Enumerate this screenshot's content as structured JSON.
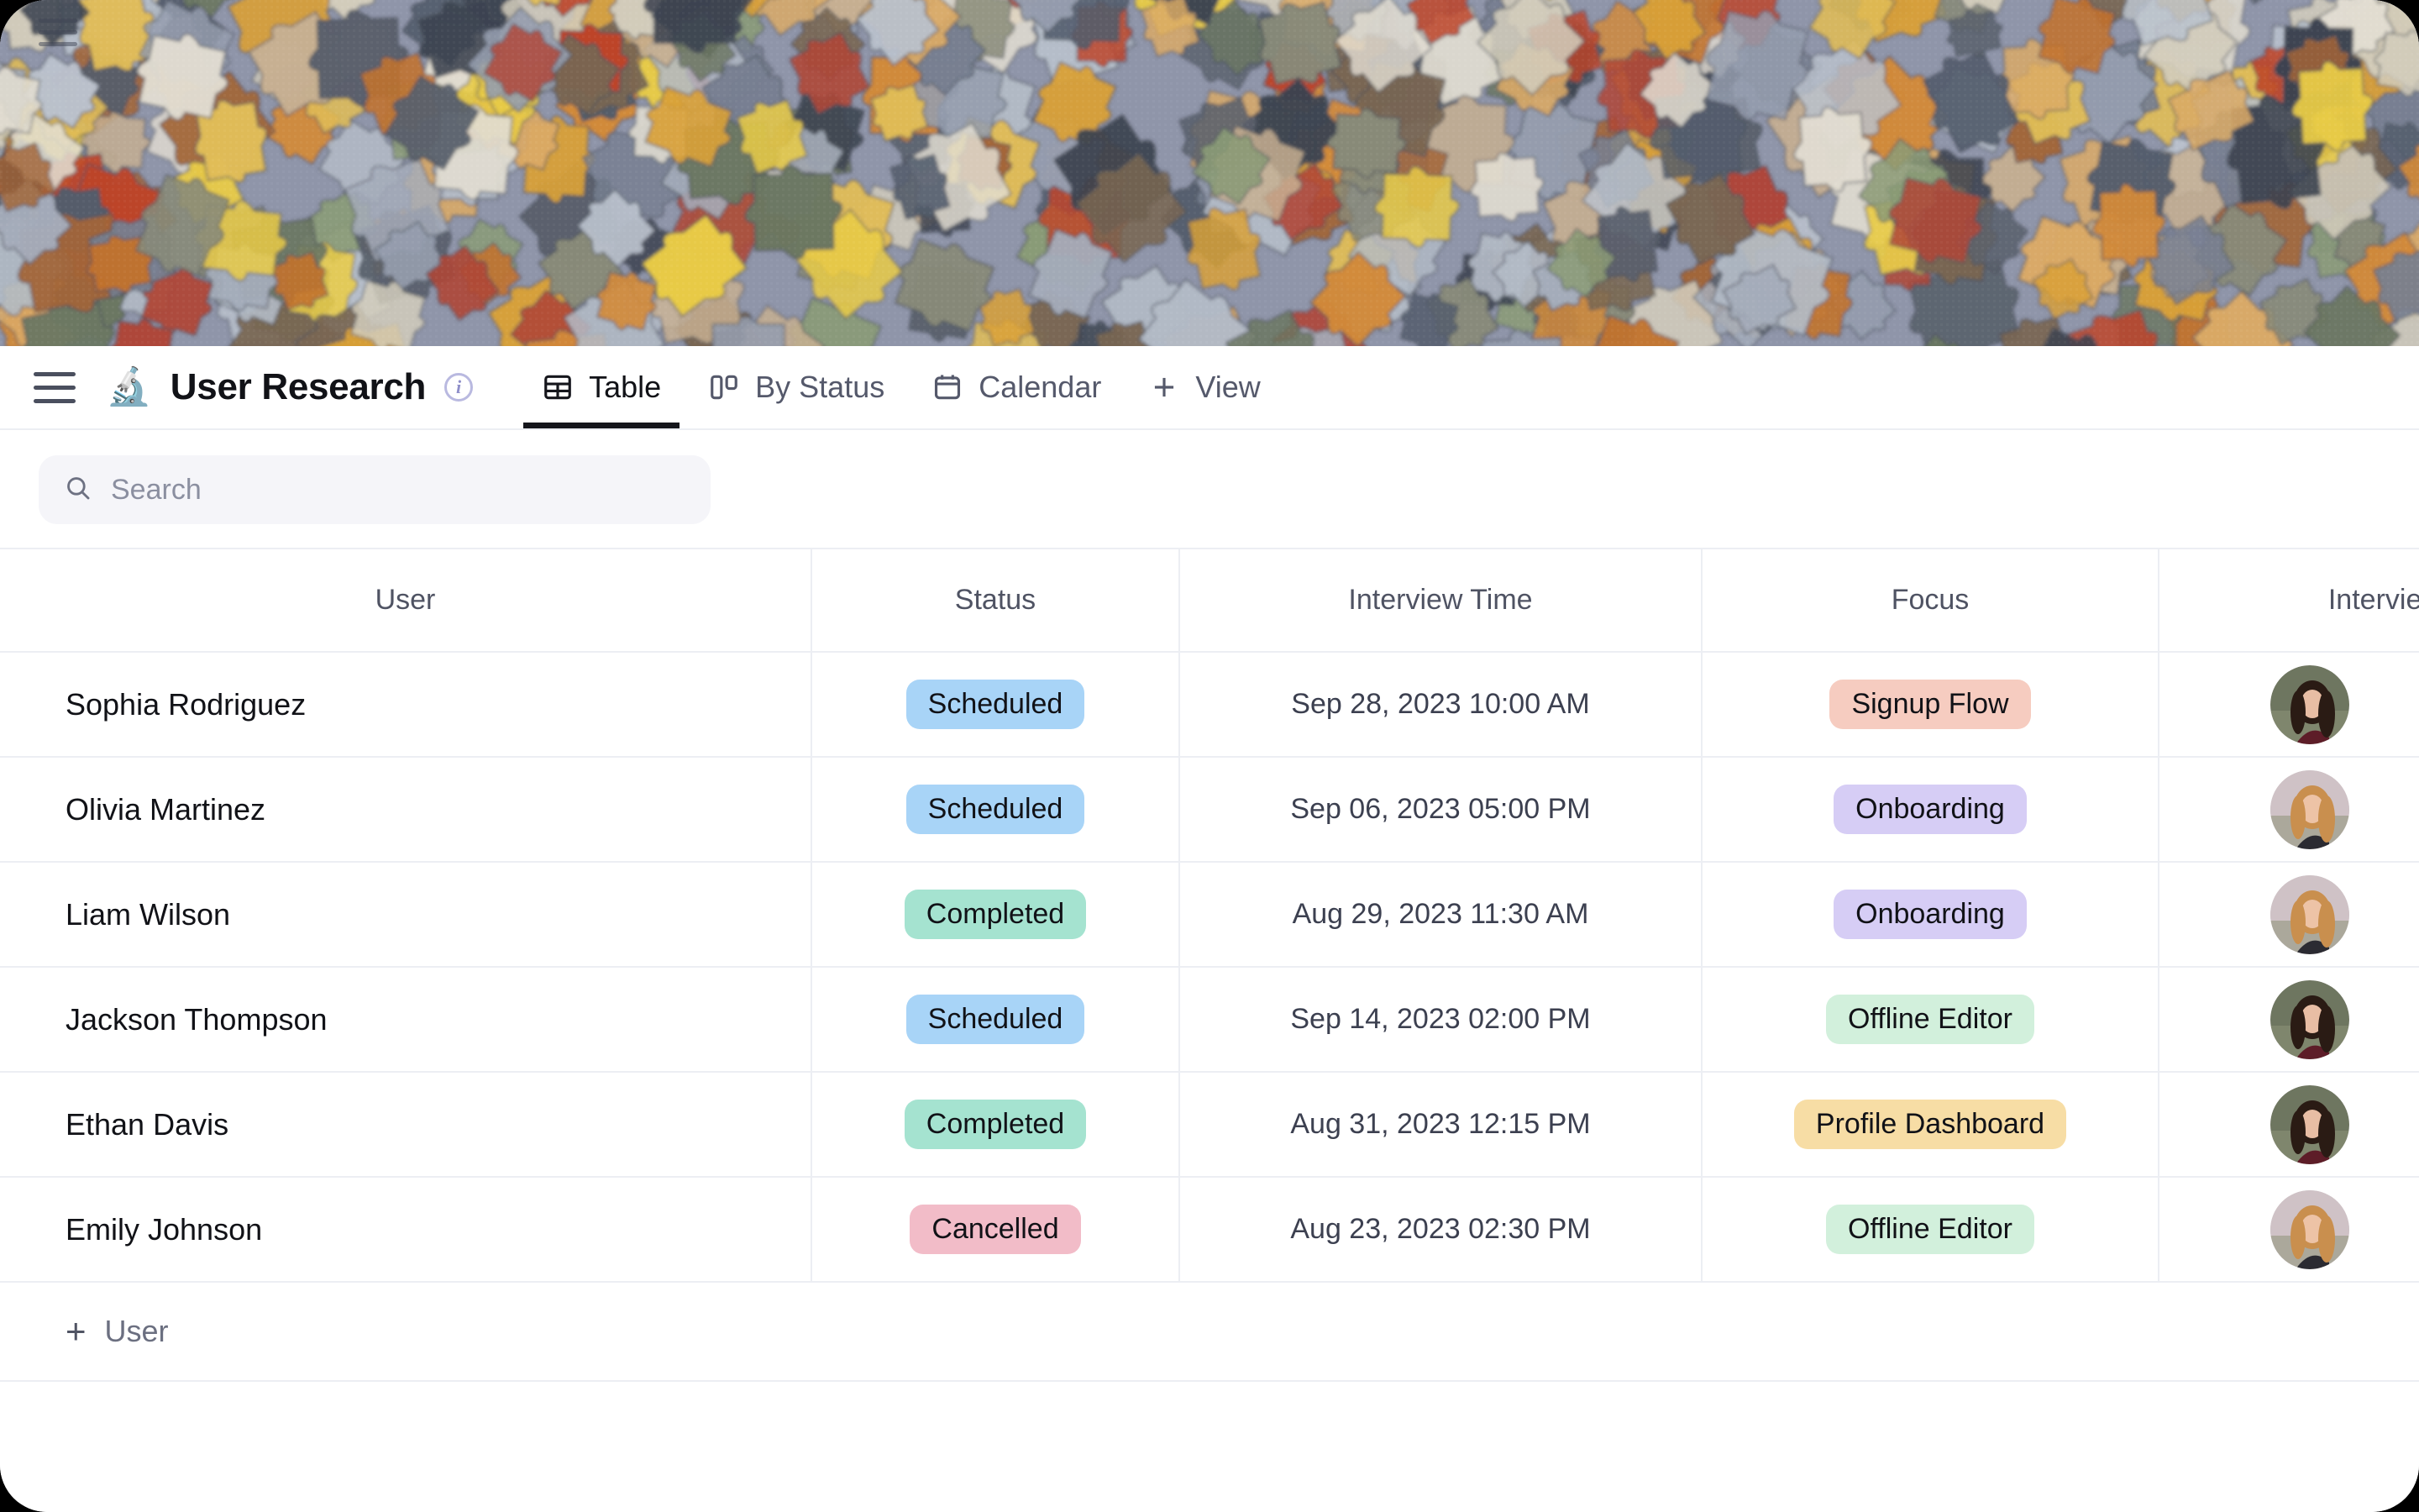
{
  "banner": {
    "alt": "jigsaw-puzzle-pieces-photo"
  },
  "header": {
    "menu_icon": "hamburger-menu-icon",
    "emoji": "🔬",
    "title": "User Research",
    "info_icon": "info-icon",
    "info_glyph": "i"
  },
  "tabs": [
    {
      "label": "Table",
      "icon": "table-icon",
      "active": true
    },
    {
      "label": "By Status",
      "icon": "board-icon",
      "active": false
    },
    {
      "label": "Calendar",
      "icon": "calendar-icon",
      "active": false
    },
    {
      "label": "View",
      "icon": "plus-icon",
      "active": false
    }
  ],
  "search": {
    "value": "",
    "placeholder": "Search",
    "icon": "search-icon"
  },
  "table": {
    "columns": [
      "User",
      "Status",
      "Interview Time",
      "Focus",
      "Interviewer"
    ],
    "rows": [
      {
        "user": "Sophia Rodriguez",
        "status": "Scheduled",
        "status_color": "#a8d4f7",
        "time": "Sep 28, 2023 10:00 AM",
        "focus": "Signup Flow",
        "focus_color": "#f6ccc0",
        "interviewer": "avatar-dark-hair-woman"
      },
      {
        "user": "Olivia Martinez",
        "status": "Scheduled",
        "status_color": "#a8d4f7",
        "time": "Sep 06, 2023 05:00 PM",
        "focus": "Onboarding",
        "focus_color": "#d6cdf5",
        "interviewer": "avatar-blonde-woman"
      },
      {
        "user": "Liam Wilson",
        "status": "Completed",
        "status_color": "#a5e3d0",
        "time": "Aug 29, 2023 11:30 AM",
        "focus": "Onboarding",
        "focus_color": "#d6cdf5",
        "interviewer": "avatar-blonde-woman"
      },
      {
        "user": "Jackson Thompson",
        "status": "Scheduled",
        "status_color": "#a8d4f7",
        "time": "Sep 14, 2023 02:00 PM",
        "focus": "Offline Editor",
        "focus_color": "#d2f0dc",
        "interviewer": "avatar-dark-hair-woman"
      },
      {
        "user": "Ethan Davis",
        "status": "Completed",
        "status_color": "#a5e3d0",
        "time": "Aug 31, 2023 12:15 PM",
        "focus": "Profile Dashboard",
        "focus_color": "#f7dda5",
        "interviewer": "avatar-dark-hair-woman"
      },
      {
        "user": "Emily Johnson",
        "status": "Cancelled",
        "status_color": "#f2bcc8",
        "time": "Aug 23, 2023 02:30 PM",
        "focus": "Offline Editor",
        "focus_color": "#d2f0dc",
        "interviewer": "avatar-blonde-woman"
      }
    ]
  },
  "add_row": {
    "label": "User",
    "icon": "plus-icon"
  }
}
